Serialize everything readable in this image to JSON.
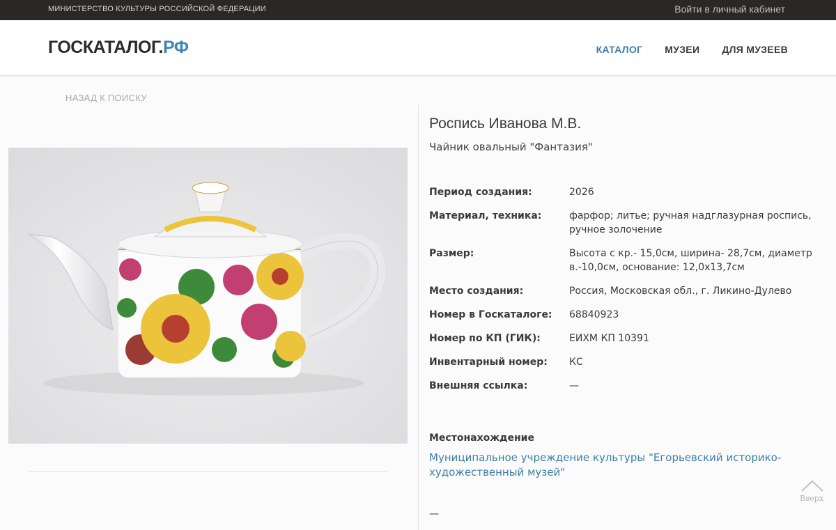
{
  "topbar": {
    "ministry": "МИНИСТЕРСТВО КУЛЬТУРЫ РОССИЙСКОЙ ФЕДЕРАЦИИ",
    "login": "Войти в личный кабинет"
  },
  "header": {
    "logo_main": "ГОСКАТАЛОГ.",
    "logo_accent": "РФ",
    "nav": [
      {
        "label": "КАТАЛОГ",
        "active": true
      },
      {
        "label": "МУЗЕИ",
        "active": false
      },
      {
        "label": "ДЛЯ МУЗЕЕВ",
        "active": false
      }
    ]
  },
  "back_link": "НАЗАД К ПОИСКУ",
  "item": {
    "title": "Роспись Иванова М.В.",
    "subtitle": "Чайник овальный \"Фантазия\"",
    "properties": [
      {
        "key": "Период создания:",
        "value": "2026"
      },
      {
        "key": "Материал, техника:",
        "value": "фарфор; литье; ручная надглазурная роспись, ручное золочение"
      },
      {
        "key": "Размер:",
        "value": "Высота с кр.- 15,0см, ширина- 28,7см, диаметр в.-10,0см, основание: 12,0х13,7см"
      },
      {
        "key": "Место создания:",
        "value": "Россия, Московская обл., г. Ликино-Дулево"
      },
      {
        "key": "Номер в Госкаталоге:",
        "value": "68840923"
      },
      {
        "key": "Номер по КП (ГИК):",
        "value": "ЕИХМ КП 10391"
      },
      {
        "key": "Инвентарный номер:",
        "value": "КС"
      },
      {
        "key": "Внешняя ссылка:",
        "value": "—"
      }
    ],
    "location_heading": "Местонахождение",
    "location_link": "Муниципальное учреждение культуры \"Егорьевский историко-художественный музей\"",
    "footer_dash": "—"
  },
  "scroll_top_label": "Вверх",
  "colors": {
    "accent": "#3d7ea8",
    "topbar_bg": "#2a2826",
    "page_bg": "#fbfbfb"
  }
}
